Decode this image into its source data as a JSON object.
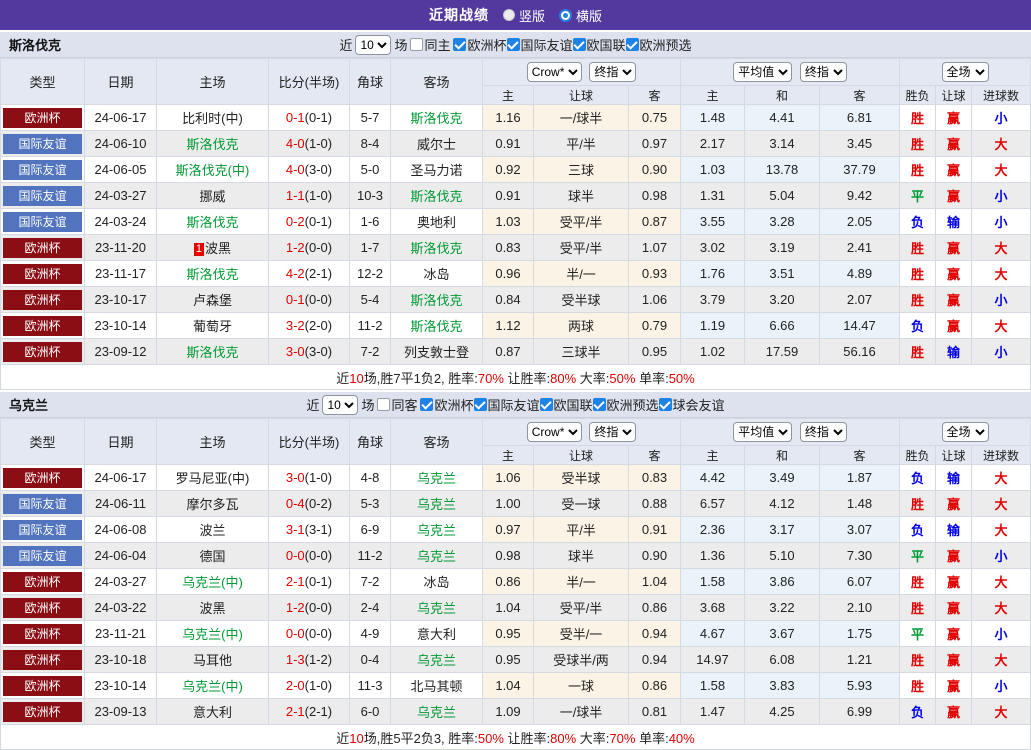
{
  "top_bar": {
    "title": "近期战绩",
    "layout_options": [
      {
        "label": "竖版",
        "selected": false
      },
      {
        "label": "横版",
        "selected": true
      }
    ]
  },
  "columns": {
    "main": [
      "类型",
      "日期",
      "主场",
      "比分(半场)",
      "角球",
      "客场"
    ],
    "sub": [
      "主",
      "让球",
      "客",
      "主",
      "和",
      "客",
      "胜负",
      "让球",
      "进球数"
    ]
  },
  "colors": {
    "accent_purple": "#53399e",
    "type_cup": "#8a0e13",
    "type_friendly": "#5273bd",
    "team_green": "#009933",
    "score_red": "#e30000",
    "loss_blue": "#0000e6"
  },
  "sections": [
    {
      "team": "斯洛伐克",
      "filter": {
        "near_label": "近",
        "games_label": "场",
        "same_label": "同主",
        "same_checked": false,
        "competitions": [
          {
            "label": "欧洲杯",
            "checked": true
          },
          {
            "label": "国际友谊",
            "checked": true
          },
          {
            "label": "欧国联",
            "checked": true
          },
          {
            "label": "欧洲预选",
            "checked": true
          }
        ]
      },
      "controls": {
        "count": "10",
        "source": "Crow*",
        "source_time": "终指",
        "avg": "平均值",
        "avg_time": "终指",
        "scope": "全场"
      },
      "rows": [
        {
          "type": "欧洲杯",
          "type_color": "cup",
          "date": "24-06-17",
          "home": "比利时(中)",
          "home_green": false,
          "home_badge": "",
          "score": "0-1",
          "half": "(0-1)",
          "corner": "5-7",
          "away": "斯洛伐克",
          "away_green": true,
          "odds": [
            "1.16",
            "一/球半",
            "0.75"
          ],
          "avg": [
            "1.48",
            "4.41",
            "6.81"
          ],
          "results": [
            {
              "t": "胜",
              "c": "red"
            },
            {
              "t": "赢",
              "c": "red"
            },
            {
              "t": "小",
              "c": "blue"
            }
          ]
        },
        {
          "type": "国际友谊",
          "type_color": "fr",
          "date": "24-06-10",
          "home": "斯洛伐克",
          "home_green": true,
          "home_badge": "",
          "score": "4-0",
          "half": "(1-0)",
          "corner": "8-4",
          "away": "威尔士",
          "away_green": false,
          "odds": [
            "0.91",
            "平/半",
            "0.97"
          ],
          "avg": [
            "2.17",
            "3.14",
            "3.45"
          ],
          "results": [
            {
              "t": "胜",
              "c": "red"
            },
            {
              "t": "赢",
              "c": "red"
            },
            {
              "t": "大",
              "c": "red"
            }
          ]
        },
        {
          "type": "国际友谊",
          "type_color": "fr",
          "date": "24-06-05",
          "home": "斯洛伐克(中)",
          "home_green": true,
          "home_badge": "",
          "score": "4-0",
          "half": "(3-0)",
          "corner": "5-0",
          "away": "圣马力诺",
          "away_green": false,
          "odds": [
            "0.92",
            "三球",
            "0.90"
          ],
          "avg": [
            "1.03",
            "13.78",
            "37.79"
          ],
          "results": [
            {
              "t": "胜",
              "c": "red"
            },
            {
              "t": "赢",
              "c": "red"
            },
            {
              "t": "大",
              "c": "red"
            }
          ]
        },
        {
          "type": "国际友谊",
          "type_color": "fr",
          "date": "24-03-27",
          "home": "挪威",
          "home_green": false,
          "home_badge": "",
          "score": "1-1",
          "half": "(1-0)",
          "corner": "10-3",
          "away": "斯洛伐克",
          "away_green": true,
          "odds": [
            "0.91",
            "球半",
            "0.98"
          ],
          "avg": [
            "1.31",
            "5.04",
            "9.42"
          ],
          "results": [
            {
              "t": "平",
              "c": "green"
            },
            {
              "t": "赢",
              "c": "red"
            },
            {
              "t": "小",
              "c": "blue"
            }
          ]
        },
        {
          "type": "国际友谊",
          "type_color": "fr",
          "date": "24-03-24",
          "home": "斯洛伐克",
          "home_green": true,
          "home_badge": "",
          "score": "0-2",
          "half": "(0-1)",
          "corner": "1-6",
          "away": "奥地利",
          "away_green": false,
          "odds": [
            "1.03",
            "受平/半",
            "0.87"
          ],
          "avg": [
            "3.55",
            "3.28",
            "2.05"
          ],
          "results": [
            {
              "t": "负",
              "c": "blue"
            },
            {
              "t": "输",
              "c": "blue"
            },
            {
              "t": "小",
              "c": "blue"
            }
          ]
        },
        {
          "type": "欧洲杯",
          "type_color": "cup",
          "date": "23-11-20",
          "home": "波黑",
          "home_green": false,
          "home_badge": "1",
          "score": "1-2",
          "half": "(0-0)",
          "corner": "1-7",
          "away": "斯洛伐克",
          "away_green": true,
          "odds": [
            "0.83",
            "受平/半",
            "1.07"
          ],
          "avg": [
            "3.02",
            "3.19",
            "2.41"
          ],
          "results": [
            {
              "t": "胜",
              "c": "red"
            },
            {
              "t": "赢",
              "c": "red"
            },
            {
              "t": "大",
              "c": "red"
            }
          ]
        },
        {
          "type": "欧洲杯",
          "type_color": "cup",
          "date": "23-11-17",
          "home": "斯洛伐克",
          "home_green": true,
          "home_badge": "",
          "score": "4-2",
          "half": "(2-1)",
          "corner": "12-2",
          "away": "冰岛",
          "away_green": false,
          "odds": [
            "0.96",
            "半/一",
            "0.93"
          ],
          "avg": [
            "1.76",
            "3.51",
            "4.89"
          ],
          "results": [
            {
              "t": "胜",
              "c": "red"
            },
            {
              "t": "赢",
              "c": "red"
            },
            {
              "t": "大",
              "c": "red"
            }
          ]
        },
        {
          "type": "欧洲杯",
          "type_color": "cup",
          "date": "23-10-17",
          "home": "卢森堡",
          "home_green": false,
          "home_badge": "",
          "score": "0-1",
          "half": "(0-0)",
          "corner": "5-4",
          "away": "斯洛伐克",
          "away_green": true,
          "odds": [
            "0.84",
            "受半球",
            "1.06"
          ],
          "avg": [
            "3.79",
            "3.20",
            "2.07"
          ],
          "results": [
            {
              "t": "胜",
              "c": "red"
            },
            {
              "t": "赢",
              "c": "red"
            },
            {
              "t": "小",
              "c": "blue"
            }
          ]
        },
        {
          "type": "欧洲杯",
          "type_color": "cup",
          "date": "23-10-14",
          "home": "葡萄牙",
          "home_green": false,
          "home_badge": "",
          "score": "3-2",
          "half": "(2-0)",
          "corner": "11-2",
          "away": "斯洛伐克",
          "away_green": true,
          "odds": [
            "1.12",
            "两球",
            "0.79"
          ],
          "avg": [
            "1.19",
            "6.66",
            "14.47"
          ],
          "results": [
            {
              "t": "负",
              "c": "blue"
            },
            {
              "t": "赢",
              "c": "red"
            },
            {
              "t": "大",
              "c": "red"
            }
          ]
        },
        {
          "type": "欧洲杯",
          "type_color": "cup",
          "date": "23-09-12",
          "home": "斯洛伐克",
          "home_green": true,
          "home_badge": "",
          "score": "3-0",
          "half": "(3-0)",
          "corner": "7-2",
          "away": "列支敦士登",
          "away_green": false,
          "odds": [
            "0.87",
            "三球半",
            "0.95"
          ],
          "avg": [
            "1.02",
            "17.59",
            "56.16"
          ],
          "results": [
            {
              "t": "胜",
              "c": "red"
            },
            {
              "t": "输",
              "c": "blue"
            },
            {
              "t": "小",
              "c": "blue"
            }
          ]
        }
      ],
      "summary": [
        {
          "text": "近",
          "red": false
        },
        {
          "text": "10",
          "red": true
        },
        {
          "text": "场,胜7平1负2, 胜率:",
          "red": false
        },
        {
          "text": "70%",
          "red": true
        },
        {
          "text": " 让胜率:",
          "red": false
        },
        {
          "text": "80%",
          "red": true
        },
        {
          "text": " 大率:",
          "red": false
        },
        {
          "text": "50%",
          "red": true
        },
        {
          "text": " 单率:",
          "red": false
        },
        {
          "text": "50%",
          "red": true
        }
      ]
    },
    {
      "team": "乌克兰",
      "filter": {
        "near_label": "近",
        "games_label": "场",
        "same_label": "同客",
        "same_checked": false,
        "competitions": [
          {
            "label": "欧洲杯",
            "checked": true
          },
          {
            "label": "国际友谊",
            "checked": true
          },
          {
            "label": "欧国联",
            "checked": true
          },
          {
            "label": "欧洲预选",
            "checked": true
          },
          {
            "label": "球会友谊",
            "checked": true
          }
        ]
      },
      "controls": {
        "count": "10",
        "source": "Crow*",
        "source_time": "终指",
        "avg": "平均值",
        "avg_time": "终指",
        "scope": "全场"
      },
      "rows": [
        {
          "type": "欧洲杯",
          "type_color": "cup",
          "date": "24-06-17",
          "home": "罗马尼亚(中)",
          "home_green": false,
          "home_badge": "",
          "score": "3-0",
          "half": "(1-0)",
          "corner": "4-8",
          "away": "乌克兰",
          "away_green": true,
          "odds": [
            "1.06",
            "受半球",
            "0.83"
          ],
          "avg": [
            "4.42",
            "3.49",
            "1.87"
          ],
          "results": [
            {
              "t": "负",
              "c": "blue"
            },
            {
              "t": "输",
              "c": "blue"
            },
            {
              "t": "大",
              "c": "red"
            }
          ]
        },
        {
          "type": "国际友谊",
          "type_color": "fr",
          "date": "24-06-11",
          "home": "摩尔多瓦",
          "home_green": false,
          "home_badge": "",
          "score": "0-4",
          "half": "(0-2)",
          "corner": "5-3",
          "away": "乌克兰",
          "away_green": true,
          "odds": [
            "1.00",
            "受一球",
            "0.88"
          ],
          "avg": [
            "6.57",
            "4.12",
            "1.48"
          ],
          "results": [
            {
              "t": "胜",
              "c": "red"
            },
            {
              "t": "赢",
              "c": "red"
            },
            {
              "t": "大",
              "c": "red"
            }
          ]
        },
        {
          "type": "国际友谊",
          "type_color": "fr",
          "date": "24-06-08",
          "home": "波兰",
          "home_green": false,
          "home_badge": "",
          "score": "3-1",
          "half": "(3-1)",
          "corner": "6-9",
          "away": "乌克兰",
          "away_green": true,
          "odds": [
            "0.97",
            "平/半",
            "0.91"
          ],
          "avg": [
            "2.36",
            "3.17",
            "3.07"
          ],
          "results": [
            {
              "t": "负",
              "c": "blue"
            },
            {
              "t": "输",
              "c": "blue"
            },
            {
              "t": "大",
              "c": "red"
            }
          ]
        },
        {
          "type": "国际友谊",
          "type_color": "fr",
          "date": "24-06-04",
          "home": "德国",
          "home_green": false,
          "home_badge": "",
          "score": "0-0",
          "half": "(0-0)",
          "corner": "11-2",
          "away": "乌克兰",
          "away_green": true,
          "odds": [
            "0.98",
            "球半",
            "0.90"
          ],
          "avg": [
            "1.36",
            "5.10",
            "7.30"
          ],
          "results": [
            {
              "t": "平",
              "c": "green"
            },
            {
              "t": "赢",
              "c": "red"
            },
            {
              "t": "小",
              "c": "blue"
            }
          ]
        },
        {
          "type": "欧洲杯",
          "type_color": "cup",
          "date": "24-03-27",
          "home": "乌克兰(中)",
          "home_green": true,
          "home_badge": "",
          "score": "2-1",
          "half": "(0-1)",
          "corner": "7-2",
          "away": "冰岛",
          "away_green": false,
          "odds": [
            "0.86",
            "半/一",
            "1.04"
          ],
          "avg": [
            "1.58",
            "3.86",
            "6.07"
          ],
          "results": [
            {
              "t": "胜",
              "c": "red"
            },
            {
              "t": "赢",
              "c": "red"
            },
            {
              "t": "大",
              "c": "red"
            }
          ]
        },
        {
          "type": "欧洲杯",
          "type_color": "cup",
          "date": "24-03-22",
          "home": "波黑",
          "home_green": false,
          "home_badge": "",
          "score": "1-2",
          "half": "(0-0)",
          "corner": "2-4",
          "away": "乌克兰",
          "away_green": true,
          "odds": [
            "1.04",
            "受平/半",
            "0.86"
          ],
          "avg": [
            "3.68",
            "3.22",
            "2.10"
          ],
          "results": [
            {
              "t": "胜",
              "c": "red"
            },
            {
              "t": "赢",
              "c": "red"
            },
            {
              "t": "大",
              "c": "red"
            }
          ]
        },
        {
          "type": "欧洲杯",
          "type_color": "cup",
          "date": "23-11-21",
          "home": "乌克兰(中)",
          "home_green": true,
          "home_badge": "",
          "score": "0-0",
          "half": "(0-0)",
          "corner": "4-9",
          "away": "意大利",
          "away_green": false,
          "odds": [
            "0.95",
            "受半/一",
            "0.94"
          ],
          "avg": [
            "4.67",
            "3.67",
            "1.75"
          ],
          "results": [
            {
              "t": "平",
              "c": "green"
            },
            {
              "t": "赢",
              "c": "red"
            },
            {
              "t": "小",
              "c": "blue"
            }
          ]
        },
        {
          "type": "欧洲杯",
          "type_color": "cup",
          "date": "23-10-18",
          "home": "马耳他",
          "home_green": false,
          "home_badge": "",
          "score": "1-3",
          "half": "(1-2)",
          "corner": "0-4",
          "away": "乌克兰",
          "away_green": true,
          "odds": [
            "0.95",
            "受球半/两",
            "0.94"
          ],
          "avg": [
            "14.97",
            "6.08",
            "1.21"
          ],
          "results": [
            {
              "t": "胜",
              "c": "red"
            },
            {
              "t": "赢",
              "c": "red"
            },
            {
              "t": "大",
              "c": "red"
            }
          ]
        },
        {
          "type": "欧洲杯",
          "type_color": "cup",
          "date": "23-10-14",
          "home": "乌克兰(中)",
          "home_green": true,
          "home_badge": "",
          "score": "2-0",
          "half": "(1-0)",
          "corner": "11-3",
          "away": "北马其顿",
          "away_green": false,
          "odds": [
            "1.04",
            "一球",
            "0.86"
          ],
          "avg": [
            "1.58",
            "3.83",
            "5.93"
          ],
          "results": [
            {
              "t": "胜",
              "c": "red"
            },
            {
              "t": "赢",
              "c": "red"
            },
            {
              "t": "小",
              "c": "blue"
            }
          ]
        },
        {
          "type": "欧洲杯",
          "type_color": "cup",
          "date": "23-09-13",
          "home": "意大利",
          "home_green": false,
          "home_badge": "",
          "score": "2-1",
          "half": "(2-1)",
          "corner": "6-0",
          "away": "乌克兰",
          "away_green": true,
          "odds": [
            "1.09",
            "一/球半",
            "0.81"
          ],
          "avg": [
            "1.47",
            "4.25",
            "6.99"
          ],
          "results": [
            {
              "t": "负",
              "c": "blue"
            },
            {
              "t": "赢",
              "c": "red"
            },
            {
              "t": "大",
              "c": "red"
            }
          ]
        }
      ],
      "summary": [
        {
          "text": "近",
          "red": false
        },
        {
          "text": "10",
          "red": true
        },
        {
          "text": "场,胜5平2负3, 胜率:",
          "red": false
        },
        {
          "text": "50%",
          "red": true
        },
        {
          "text": " 让胜率:",
          "red": false
        },
        {
          "text": "80%",
          "red": true
        },
        {
          "text": " 大率:",
          "red": false
        },
        {
          "text": "70%",
          "red": true
        },
        {
          "text": " 单率:",
          "red": false
        },
        {
          "text": "40%",
          "red": true
        }
      ]
    }
  ]
}
